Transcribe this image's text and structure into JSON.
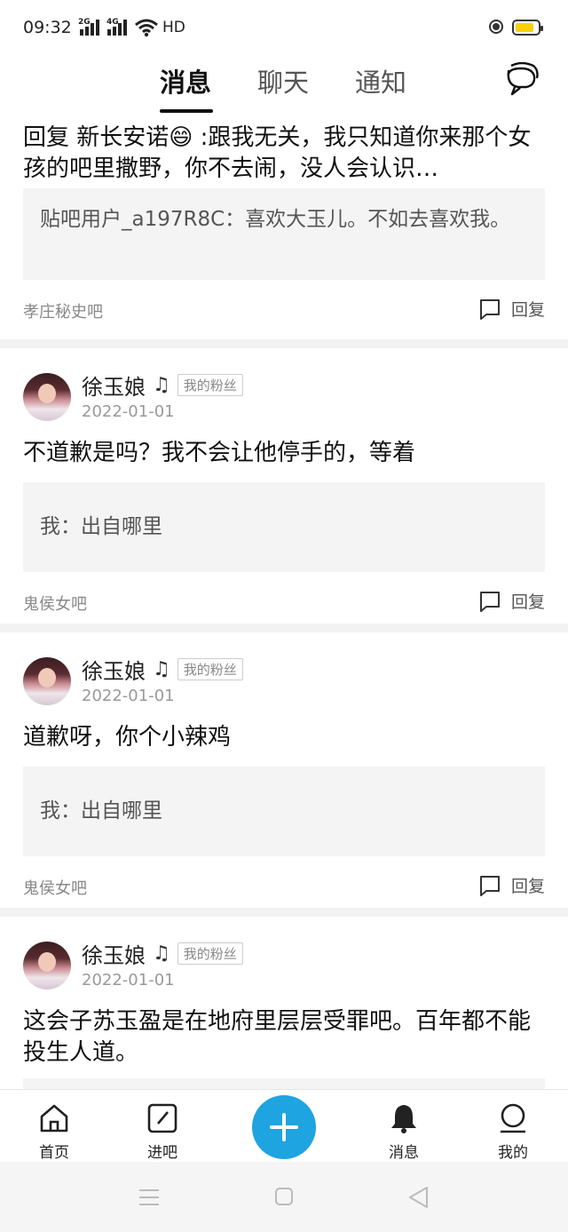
{
  "status_bar": {
    "time": "09:32",
    "sim1": "2G",
    "sim2": "4G",
    "network": "HD"
  },
  "top_tabs": [
    {
      "label": "消息",
      "active": true
    },
    {
      "label": "聊天",
      "active": false
    },
    {
      "label": "通知",
      "active": false
    }
  ],
  "reply_card": {
    "text": "回复  新长安诺😄 :跟我无关，我只知道你来那个女孩的吧里撒野，你不去闹，没人会认识…",
    "quote": "贴吧用户_a197R8C：喜欢大玉儿。不如去喜欢我。",
    "forum": "孝庄秘史吧",
    "reply_label": "回复"
  },
  "posts": [
    {
      "user": "徐玉娘",
      "user_note_icon": "music-note-icon",
      "badge": "我的粉丝",
      "date": "2022-01-01",
      "text": "不道歉是吗？我不会让他停手的，等着",
      "quote": "我：出自哪里",
      "forum": "鬼侯女吧",
      "reply_label": "回复"
    },
    {
      "user": "徐玉娘",
      "user_note_icon": "music-note-icon",
      "badge": "我的粉丝",
      "date": "2022-01-01",
      "text": "道歉呀，你个小辣鸡",
      "quote": "我：出自哪里",
      "forum": "鬼侯女吧",
      "reply_label": "回复"
    },
    {
      "user": "徐玉娘",
      "user_note_icon": "music-note-icon",
      "badge": "我的粉丝",
      "date": "2022-01-01",
      "text": "这会子苏玉盈是在地府里层层受罪吧。百年都不能投生人道。"
    }
  ],
  "bottom_nav": {
    "home": "首页",
    "enter_forum": "进吧",
    "messages": "消息",
    "me": "我的"
  },
  "colors": {
    "accent": "#1ea4e0",
    "battery": "#f7d20a"
  }
}
